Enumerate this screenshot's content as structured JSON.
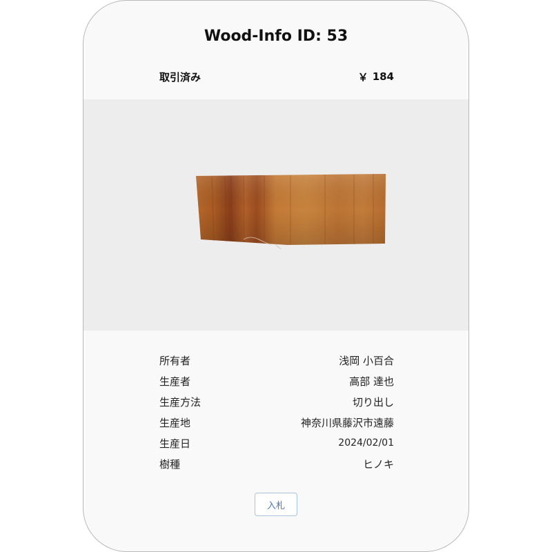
{
  "card": {
    "title": "Wood-Info ID: 53",
    "status": "取引済み",
    "currency_symbol": "￥",
    "price": "184"
  },
  "details": [
    {
      "label": "所有者",
      "value": "浅岡 小百合"
    },
    {
      "label": "生産者",
      "value": "高部 達也"
    },
    {
      "label": "生産方法",
      "value": "切り出し"
    },
    {
      "label": "生産地",
      "value": "神奈川県藤沢市遠藤"
    },
    {
      "label": "生産日",
      "value": "2024/02/01"
    },
    {
      "label": "樹種",
      "value": "ヒノキ"
    }
  ],
  "actions": {
    "bid_label": "入札"
  },
  "colors": {
    "card_background": "#f9f9f9",
    "image_background": "#ededed",
    "button_text": "#4a78b6",
    "button_border": "#a9c2e2",
    "wood_main": "#b86a28"
  },
  "image": {
    "subject": "wood-slice-photo"
  }
}
